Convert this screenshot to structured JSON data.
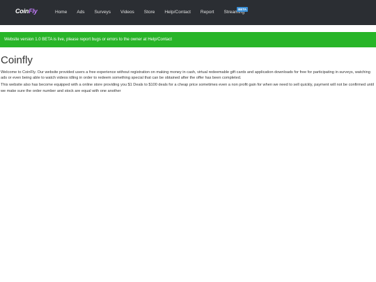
{
  "navbar": {
    "brand_main": "Coin",
    "brand_accent": "Fly",
    "items": [
      {
        "label": "Home"
      },
      {
        "label": "Ads"
      },
      {
        "label": "Surveys"
      },
      {
        "label": "Videos"
      },
      {
        "label": "Store"
      },
      {
        "label": "Help/Contact"
      },
      {
        "label": "Report"
      },
      {
        "label": "Streaming",
        "badge": "BETA"
      }
    ]
  },
  "alert": {
    "text": "Website version 1.0 BETA is live, please report bugs or errors to the owner at Help/Contact"
  },
  "main": {
    "title": "Coinfly",
    "paragraphs": [
      "Welcome to CoinFly. Our website provided users a free experience without registration on making money in cash, virtual redeemable gift cards and application downloads for free for participating in surveys, watching ads or even being able to watch videos idling in order to redeem something special that can be obtained after the offer has been completed.",
      "This website also has become equipped with a online store providing you $1 Deals to $100 deals for a cheap price sometimes even a non profit gain for when we need to sell quickly, payment will not be confirmed until we make sure the order number and stock are equal with one another"
    ]
  },
  "colors": {
    "navbar_bg": "#2b2e33",
    "alert_bg": "#28b528",
    "brand_accent": "#c77dff",
    "badge_bg": "#3a8fd6"
  }
}
